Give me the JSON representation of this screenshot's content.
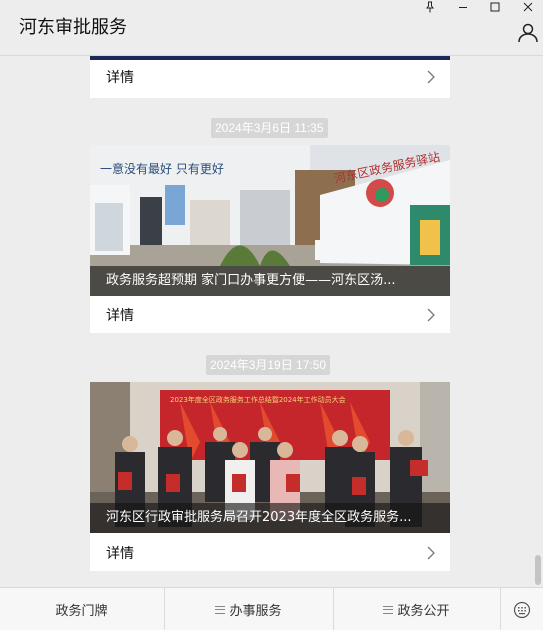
{
  "window": {
    "title": "河东审批服务",
    "controls": [
      "pin-icon",
      "minimize-icon",
      "maximize-icon",
      "close-icon"
    ],
    "user_icon": "user-icon"
  },
  "articles": [
    {
      "detail_label": "详情"
    },
    {
      "timestamp": "2024年3月6日 11:35",
      "caption": "政务服务超预期  家门口办事更方便——河东区汤...",
      "detail_label": "详情",
      "image_signs": {
        "wall_left": "一意没有最好 只有更好",
        "wall_right": "河东区政务服务驿站"
      }
    },
    {
      "timestamp": "2024年3月19日 17:50",
      "caption": "河东区行政审批服务局召开2023年度全区政务服务...",
      "detail_label": "详情",
      "image_signs": {
        "banner": "2023年度全区政务服务工作总结暨2024年工作动员大会"
      }
    }
  ],
  "bottom_menu": {
    "items": [
      "政务门牌",
      "办事服务",
      "政务公开"
    ],
    "keyboard_icon": "keyboard-icon"
  },
  "colors": {
    "background": "#ededed",
    "caption_overlay": "#141414",
    "timestamp_bg": "#d6d6d6"
  }
}
